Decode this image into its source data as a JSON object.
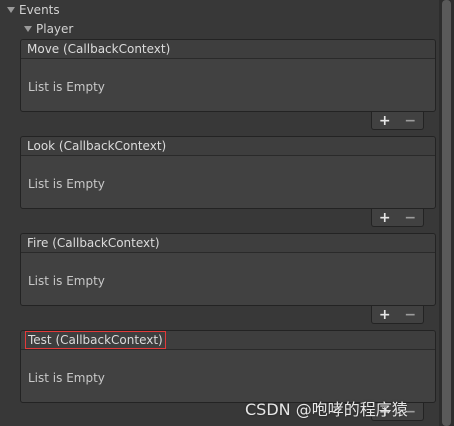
{
  "events_label": "Events",
  "player_label": "Player",
  "empty_text": "List is Empty",
  "add_label": "+",
  "remove_label": "−",
  "events": [
    {
      "title": "Move (CallbackContext)",
      "highlighted": false
    },
    {
      "title": "Look (CallbackContext)",
      "highlighted": false
    },
    {
      "title": "Fire (CallbackContext)",
      "highlighted": false
    },
    {
      "title": "Test (CallbackContext)",
      "highlighted": true
    }
  ],
  "watermark": "CSDN @咆哮的程序猿",
  "colors": {
    "background": "#383838",
    "highlight_outline": "#e23a3a"
  }
}
